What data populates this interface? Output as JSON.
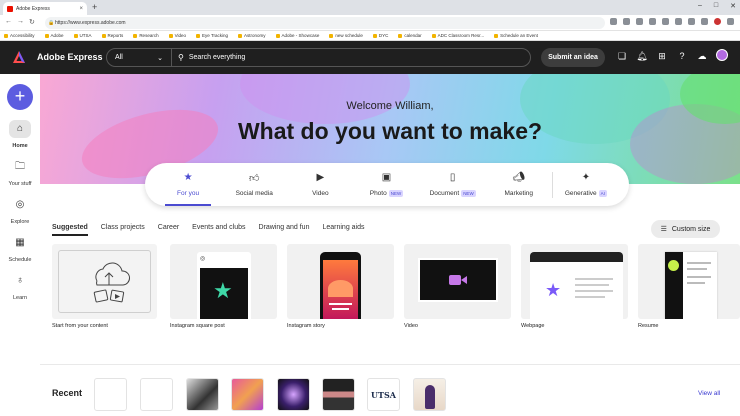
{
  "browser": {
    "tab_title": "Adobe Express",
    "url": "https://www.express.adobe.com",
    "bookmarks": [
      "Accessibility",
      "Adobe",
      "UTSA",
      "Reports",
      "Research",
      "Video",
      "Eye Tracking",
      "Astronomy",
      "Adobe - Showcase",
      "new schedule",
      "DYC",
      "calendar",
      "ADC Classroom Resr...",
      "Schedule an Event"
    ]
  },
  "header": {
    "brand": "Adobe Express",
    "search_scope": "All",
    "search_placeholder": "Search everything",
    "submit_label": "Submit an idea"
  },
  "sidebar": {
    "items": [
      {
        "label": "Home",
        "icon": "home-icon"
      },
      {
        "label": "Your stuff",
        "icon": "folder-icon"
      },
      {
        "label": "Explore",
        "icon": "compass-icon"
      },
      {
        "label": "Schedule",
        "icon": "calendar-icon"
      },
      {
        "label": "Learn",
        "icon": "lightbulb-icon"
      }
    ]
  },
  "hero": {
    "welcome": "Welcome William,",
    "headline": "What do you want to make?"
  },
  "categories": [
    {
      "label": "For you",
      "icon": "star-icon"
    },
    {
      "label": "Social media",
      "icon": "thumbs-up-icon"
    },
    {
      "label": "Video",
      "icon": "play-icon"
    },
    {
      "label": "Photo",
      "icon": "image-icon",
      "badge": "NEW"
    },
    {
      "label": "Document",
      "icon": "document-icon",
      "badge": "NEW"
    },
    {
      "label": "Marketing",
      "icon": "megaphone-icon"
    },
    {
      "label": "Generative",
      "icon": "sparkle-icon",
      "badge": "AI"
    }
  ],
  "subtabs": [
    "Suggested",
    "Class projects",
    "Career",
    "Events and clubs",
    "Drawing and fun",
    "Learning aids"
  ],
  "custom_size": "Custom size",
  "templates": [
    "Start from your content",
    "Instagram square post",
    "Instagram story",
    "Video",
    "Webpage",
    "Resume"
  ],
  "recent": {
    "title": "Recent",
    "view_all": "View all",
    "thumb_text": "UTSA"
  },
  "colors": {
    "accent": "#4b4bd1",
    "header_bg": "#1f1f1f",
    "plus_button": "#5c5ce0"
  }
}
